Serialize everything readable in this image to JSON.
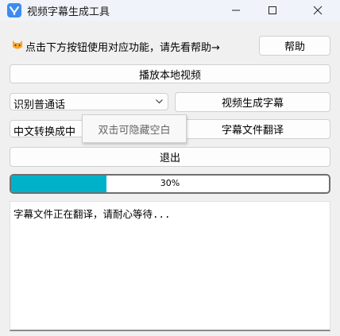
{
  "window": {
    "title": "视频字幕生成工具",
    "controls": [
      "minimize-icon",
      "maximize-icon",
      "close-icon"
    ]
  },
  "hint": {
    "icon": "cat-emoji-icon",
    "text": "点击下方按钮使用对应功能，请先看帮助→"
  },
  "buttons": {
    "help": "帮助",
    "play_local_video": "播放本地视频",
    "generate_subtitles": "视频生成字幕",
    "translate_subtitles": "字幕文件翻译",
    "exit": "退出"
  },
  "recognition_select": {
    "selected": "识别普通话"
  },
  "convert_field": {
    "value": "中文转换成中"
  },
  "tooltip": {
    "text": "双击可隐藏空白"
  },
  "progress": {
    "value": 0.3,
    "label": "30%",
    "color": "#00b1c9"
  },
  "log": {
    "text": "字幕文件正在翻译，请耐心等待..."
  }
}
